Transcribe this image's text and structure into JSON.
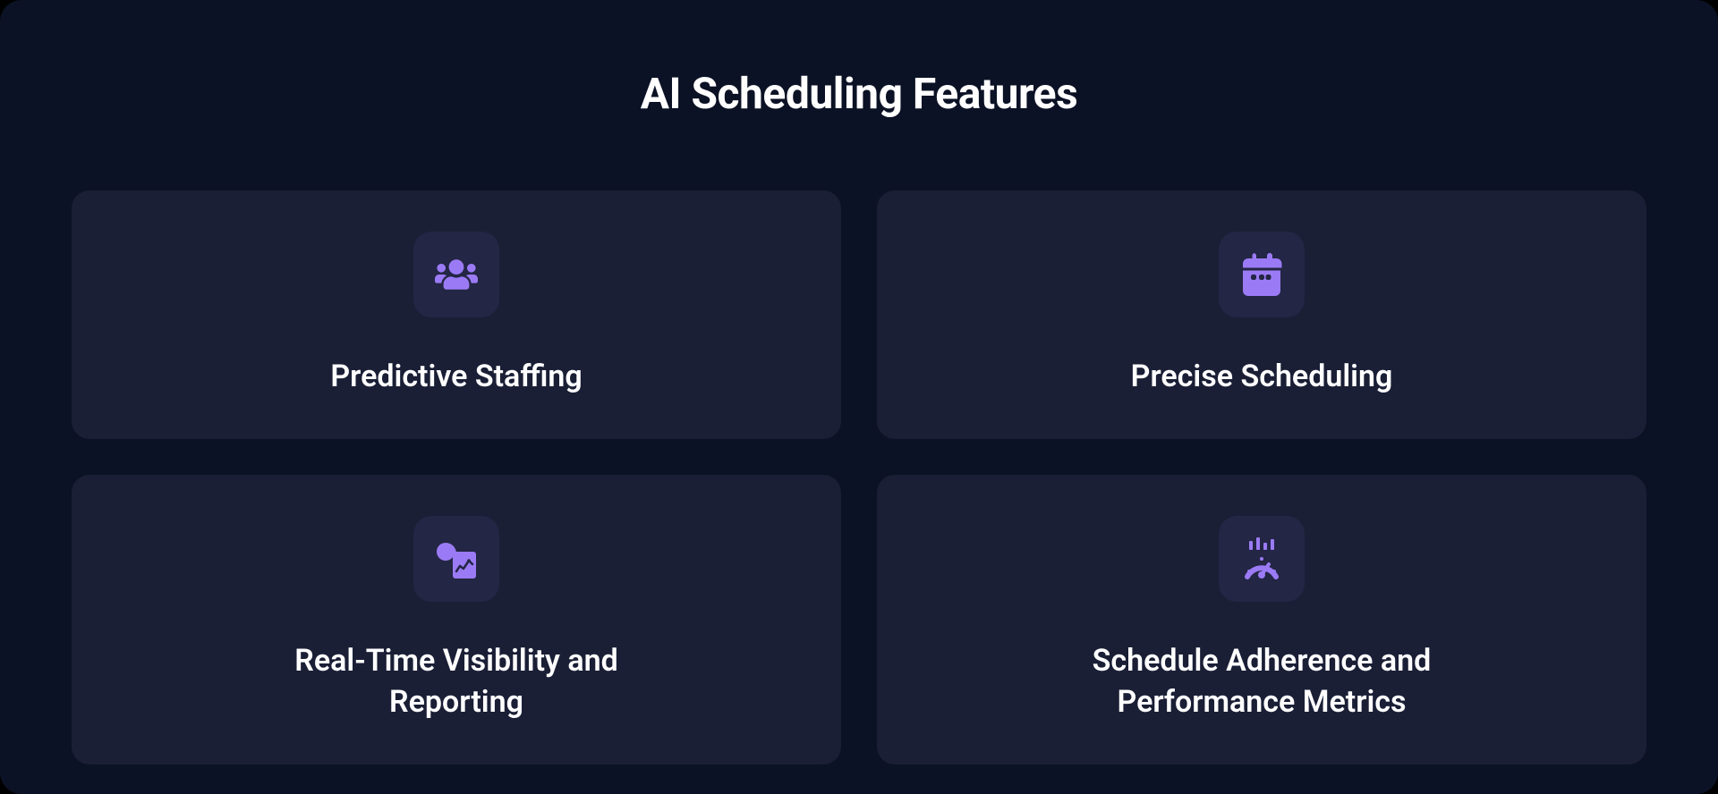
{
  "title": "AI Scheduling Features",
  "cards": [
    {
      "title": "Predictive Staffing"
    },
    {
      "title": "Precise Scheduling"
    },
    {
      "title": "Real-Time Visibility and Reporting"
    },
    {
      "title": "Schedule Adherence and Performance Metrics"
    }
  ]
}
